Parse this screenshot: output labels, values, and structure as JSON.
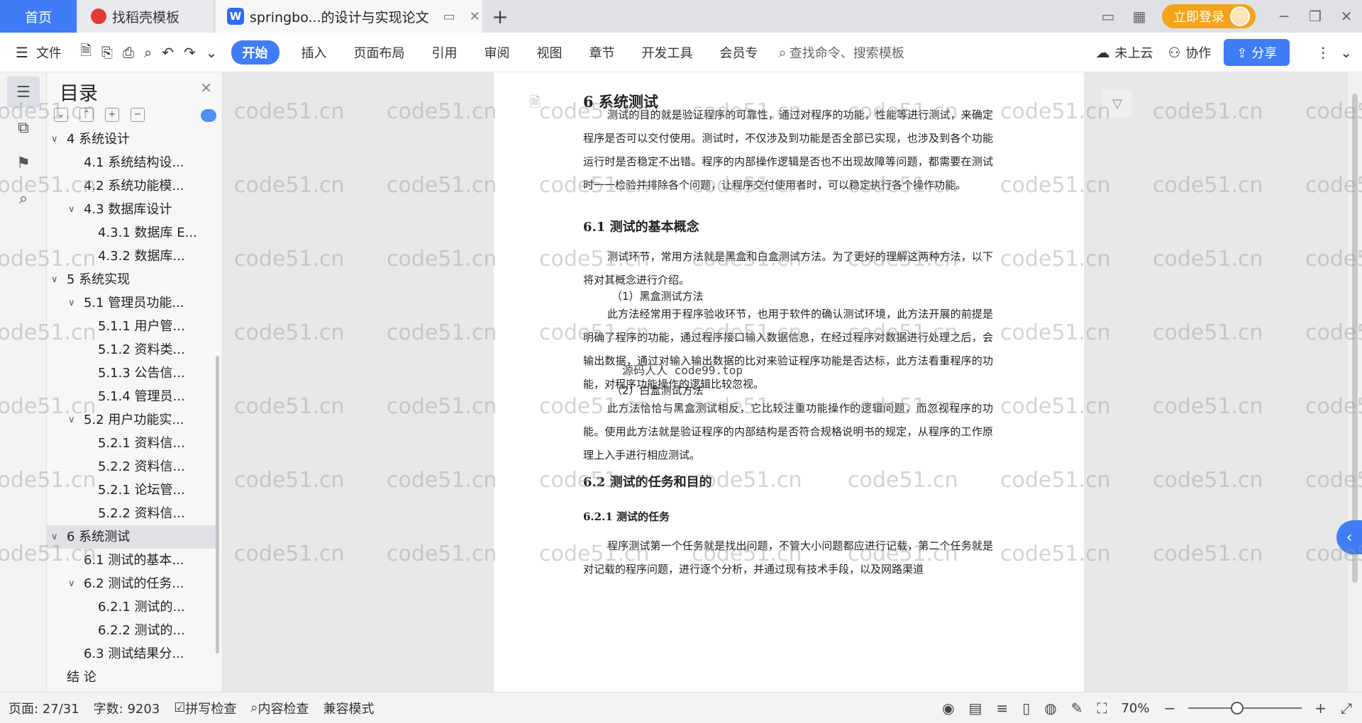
{
  "tabs": {
    "home": "首页",
    "templates": "找稻壳模板",
    "doc_title": "springbo...的设计与实现论文",
    "add": "+"
  },
  "titlebar": {
    "login": "立即登录"
  },
  "ribbon": {
    "file": "文件",
    "start": "开始",
    "insert": "插入",
    "layout": "页面布局",
    "ref": "引用",
    "review": "审阅",
    "view": "视图",
    "chapter": "章节",
    "devtools": "开发工具",
    "member": "会员专",
    "search_placeholder": "查找命令、搜索模板",
    "cloud": "未上云",
    "collab": "协作",
    "share": "分享"
  },
  "toc": {
    "title": "目录",
    "items": [
      {
        "label": "4  系统设计",
        "level": 0,
        "caret": true
      },
      {
        "label": "4.1  系统结构设...",
        "level": 1,
        "caret": false
      },
      {
        "label": "4.2  系统功能模...",
        "level": 1,
        "caret": false
      },
      {
        "label": "4.3  数据库设计",
        "level": 1,
        "caret": true
      },
      {
        "label": "4.3.1  数据库 E...",
        "level": 2,
        "caret": false
      },
      {
        "label": "4.3.2  数据库...",
        "level": 2,
        "caret": false
      },
      {
        "label": "5  系统实现",
        "level": 0,
        "caret": true
      },
      {
        "label": "5.1  管理员功能...",
        "level": 1,
        "caret": true
      },
      {
        "label": "5.1.1  用户管...",
        "level": 2,
        "caret": false
      },
      {
        "label": "5.1.2  资料类...",
        "level": 2,
        "caret": false
      },
      {
        "label": "5.1.3  公告信...",
        "level": 2,
        "caret": false
      },
      {
        "label": "5.1.4  管理员...",
        "level": 2,
        "caret": false
      },
      {
        "label": "5.2  用户功能实...",
        "level": 1,
        "caret": true
      },
      {
        "label": "5.2.1  资料信...",
        "level": 2,
        "caret": false
      },
      {
        "label": "5.2.2  资料信...",
        "level": 2,
        "caret": false
      },
      {
        "label": "5.2.1  论坛管...",
        "level": 2,
        "caret": false
      },
      {
        "label": "5.2.2  资料信...",
        "level": 2,
        "caret": false
      },
      {
        "label": "6 系统测试",
        "level": 0,
        "caret": true,
        "active": true
      },
      {
        "label": "6.1  测试的基本...",
        "level": 1,
        "caret": false
      },
      {
        "label": "6.2  测试的任务...",
        "level": 1,
        "caret": true
      },
      {
        "label": "6.2.1 测试的...",
        "level": 2,
        "caret": false
      },
      {
        "label": "6.2.2 测试的...",
        "level": 2,
        "caret": false
      },
      {
        "label": "6.3  测试结果分...",
        "level": 1,
        "caret": false
      },
      {
        "label": "结  论",
        "level": 0,
        "caret": false
      }
    ]
  },
  "document": {
    "h1": "6 系统测试",
    "p1": "测试的目的就是验证程序的可靠性，通过对程序的功能，性能等进行测试，来确定程序是否可以交付使用。测试时，不仅涉及到功能是否全部已实现，也涉及到各个功能运行时是否稳定不出错。程序的内部操作逻辑是否也不出现故障等问题，都需要在测试时一一检验并排除各个问题，让程序交付使用者时，可以稳定执行各个操作功能。",
    "h2_1": "6.1  测试的基本概念",
    "p2": "测试环节，常用方法就是黑盒和白盒测试方法。为了更好的理解这两种方法，以下将对其概念进行介绍。",
    "sub1": "（1）黑盒测试方法",
    "overlay": "源码人人 code99.top",
    "p3": "此方法经常用于程序验收环节，也用于软件的确认测试环境，此方法开展的前提是明确了程序的功能，通过程序接口输入数据信息，在经过程序对数据进行处理之后，会输出数据，通过对输入输出数据的比对来验证程序功能是否达标，此方法看重程序的功能，对程序功能操作的逻辑比较忽视。",
    "sub2": "（2）白盒测试方法",
    "p4": "此方法恰恰与黑盒测试相反，它比较注重功能操作的逻辑问题，而忽视程序的功能。使用此方法就是验证程序的内部结构是否符合规格说明书的规定，从程序的工作原理上入手进行相应测试。",
    "h2_2": "6.2  测试的任务和目的",
    "h3_1": "6.2.1 测试的任务",
    "p5": "程序测试第一个任务就是找出问题，不管大小问题都应进行记载，第二个任务就是对记载的程序问题，进行逐个分析，并通过现有技术手段，以及网路渠道"
  },
  "watermark": "code51.cn",
  "status": {
    "page": "页面: 27/31",
    "words": "字数: 9203",
    "spell": "拼写检查",
    "content": "内容检查",
    "compat": "兼容模式",
    "zoom": "70%"
  },
  "colors": {
    "accent": "#3f7cf6",
    "login": "#f5a31b"
  }
}
